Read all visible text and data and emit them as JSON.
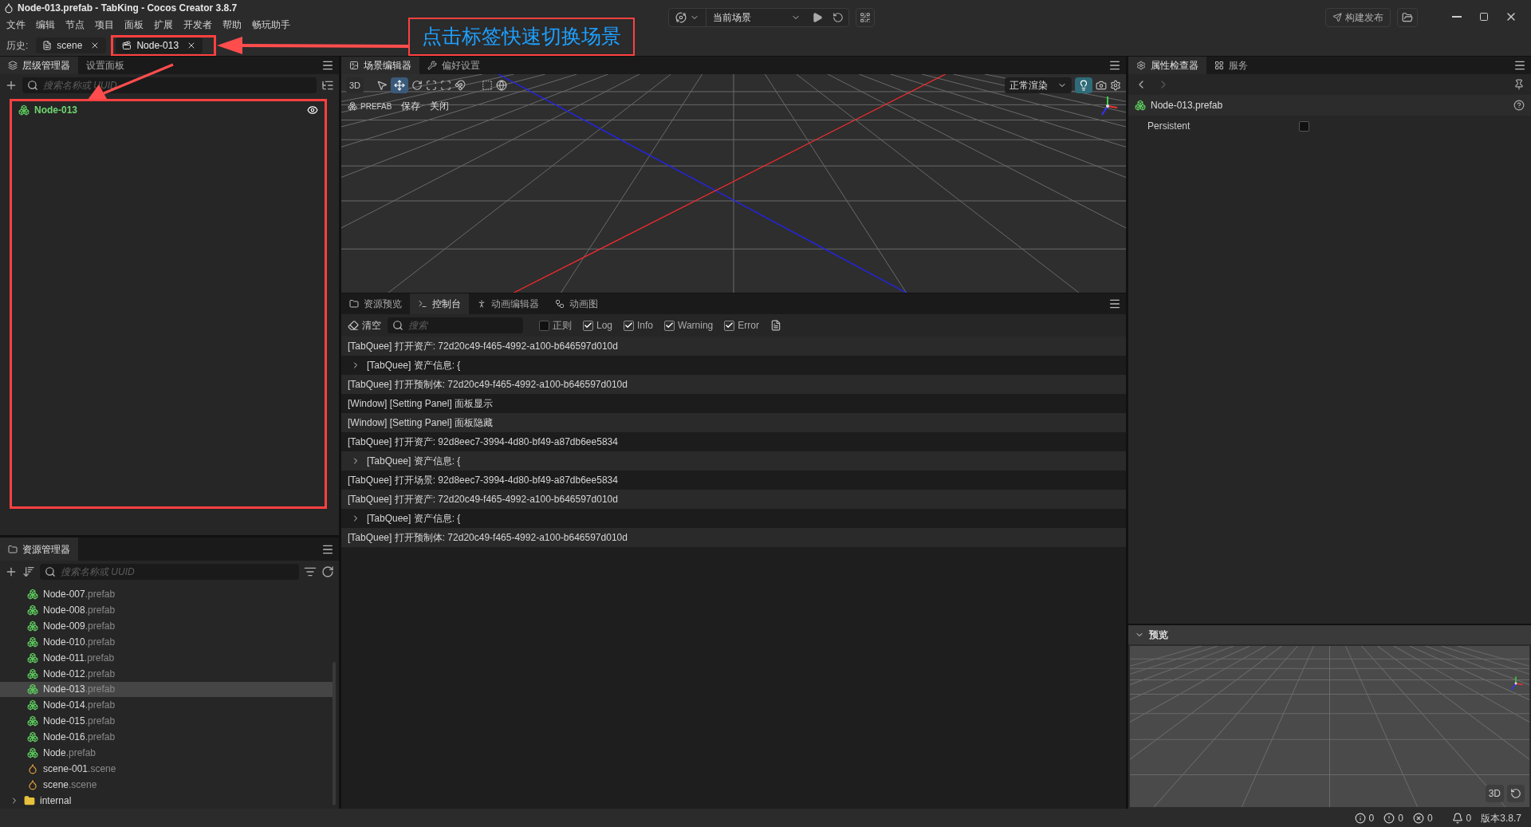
{
  "window": {
    "title": "Node-013.prefab - TabKing - Cocos Creator 3.8.7"
  },
  "menu": [
    "文件",
    "编辑",
    "节点",
    "项目",
    "面板",
    "扩展",
    "开发者",
    "帮助",
    "畅玩助手"
  ],
  "toolbar": {
    "scene_select": "当前场景",
    "build_button": "构建发布"
  },
  "history": {
    "label": "历史:",
    "tabs": [
      {
        "label": "scene",
        "kind": "scene",
        "selected": false
      },
      {
        "label": "Node-013",
        "kind": "prefab",
        "selected": true
      }
    ]
  },
  "annotation": {
    "callout": "点击标签快速切换场景"
  },
  "hierarchy": {
    "tabs": [
      {
        "label": "层级管理器",
        "selected": true
      },
      {
        "label": "设置面板",
        "selected": false
      }
    ],
    "search": {
      "placeholder": "搜索名称或 UUID"
    },
    "nodes": [
      {
        "name": "Node-013",
        "selected": false
      }
    ]
  },
  "scene_editor": {
    "tabs": [
      {
        "label": "场景编辑器",
        "kind": "scene",
        "selected": true
      },
      {
        "label": "偏好设置",
        "kind": "settings",
        "selected": false
      }
    ],
    "mode_button": "3D",
    "render_select": "正常渲染",
    "prefab_bar": {
      "label": "PREFAB",
      "buttons": [
        "保存",
        "关闭"
      ]
    }
  },
  "console": {
    "tabs": [
      {
        "label": "资源预览",
        "kind": "folder",
        "selected": false
      },
      {
        "label": "控制台",
        "kind": "terminal",
        "selected": true
      },
      {
        "label": "动画编辑器",
        "kind": "runner",
        "selected": false
      },
      {
        "label": "动画图",
        "kind": "graph",
        "selected": false
      }
    ],
    "clear_button": "清空",
    "search": {
      "placeholder": "搜索"
    },
    "filters": [
      {
        "label": "正则",
        "checked": false
      },
      {
        "label": "Log",
        "checked": true
      },
      {
        "label": "Info",
        "checked": true
      },
      {
        "label": "Warning",
        "checked": true
      },
      {
        "label": "Error",
        "checked": true
      }
    ],
    "logs": [
      {
        "text": "[TabQuee] 打开资产: 72d20c49-f465-4992-a100-b646597d010d",
        "expandable": false
      },
      {
        "text": "[TabQuee] 资产信息: {",
        "expandable": true
      },
      {
        "text": "[TabQuee] 打开预制体: 72d20c49-f465-4992-a100-b646597d010d",
        "expandable": false
      },
      {
        "text": "[Window] [Setting Panel] 面板显示",
        "expandable": false
      },
      {
        "text": "[Window] [Setting Panel] 面板隐藏",
        "expandable": false
      },
      {
        "text": "[TabQuee] 打开资产: 92d8eec7-3994-4d80-bf49-a87db6ee5834",
        "expandable": false
      },
      {
        "text": "[TabQuee] 资产信息: {",
        "expandable": true
      },
      {
        "text": "[TabQuee] 打开场景: 92d8eec7-3994-4d80-bf49-a87db6ee5834",
        "expandable": false
      },
      {
        "text": "[TabQuee] 打开资产: 72d20c49-f465-4992-a100-b646597d010d",
        "expandable": false
      },
      {
        "text": "[TabQuee] 资产信息: {",
        "expandable": true
      },
      {
        "text": "[TabQuee] 打开预制体: 72d20c49-f465-4992-a100-b646597d010d",
        "expandable": false
      }
    ]
  },
  "assets": {
    "tabs": [
      {
        "label": "资源管理器",
        "selected": true
      }
    ],
    "search": {
      "placeholder": "搜索名称或 UUID"
    },
    "items": [
      {
        "name": "Node-007",
        "ext": ".prefab",
        "kind": "prefab",
        "selected": false
      },
      {
        "name": "Node-008",
        "ext": ".prefab",
        "kind": "prefab",
        "selected": false
      },
      {
        "name": "Node-009",
        "ext": ".prefab",
        "kind": "prefab",
        "selected": false
      },
      {
        "name": "Node-010",
        "ext": ".prefab",
        "kind": "prefab",
        "selected": false
      },
      {
        "name": "Node-011",
        "ext": ".prefab",
        "kind": "prefab",
        "selected": false
      },
      {
        "name": "Node-012",
        "ext": ".prefab",
        "kind": "prefab",
        "selected": false
      },
      {
        "name": "Node-013",
        "ext": ".prefab",
        "kind": "prefab",
        "selected": true
      },
      {
        "name": "Node-014",
        "ext": ".prefab",
        "kind": "prefab",
        "selected": false
      },
      {
        "name": "Node-015",
        "ext": ".prefab",
        "kind": "prefab",
        "selected": false
      },
      {
        "name": "Node-016",
        "ext": ".prefab",
        "kind": "prefab",
        "selected": false
      },
      {
        "name": "Node",
        "ext": ".prefab",
        "kind": "prefab",
        "selected": false
      },
      {
        "name": "scene-001",
        "ext": ".scene",
        "kind": "scene",
        "selected": false
      },
      {
        "name": "scene",
        "ext": ".scene",
        "kind": "scene",
        "selected": false
      },
      {
        "name": "internal",
        "kind": "folder",
        "selected": false,
        "expanded": false
      }
    ]
  },
  "inspector": {
    "tabs": [
      {
        "label": "属性检查器",
        "selected": true
      },
      {
        "label": "服务",
        "selected": false
      }
    ],
    "asset": "Node-013.prefab",
    "properties": [
      {
        "label": "Persistent",
        "checked": false
      }
    ]
  },
  "preview": {
    "title": "预览",
    "expanded": true,
    "mode_button": "3D"
  },
  "status_bar": {
    "info": "0",
    "warnings": "0",
    "errors": "0",
    "notifications": "0",
    "version": "版本3.8.7"
  }
}
